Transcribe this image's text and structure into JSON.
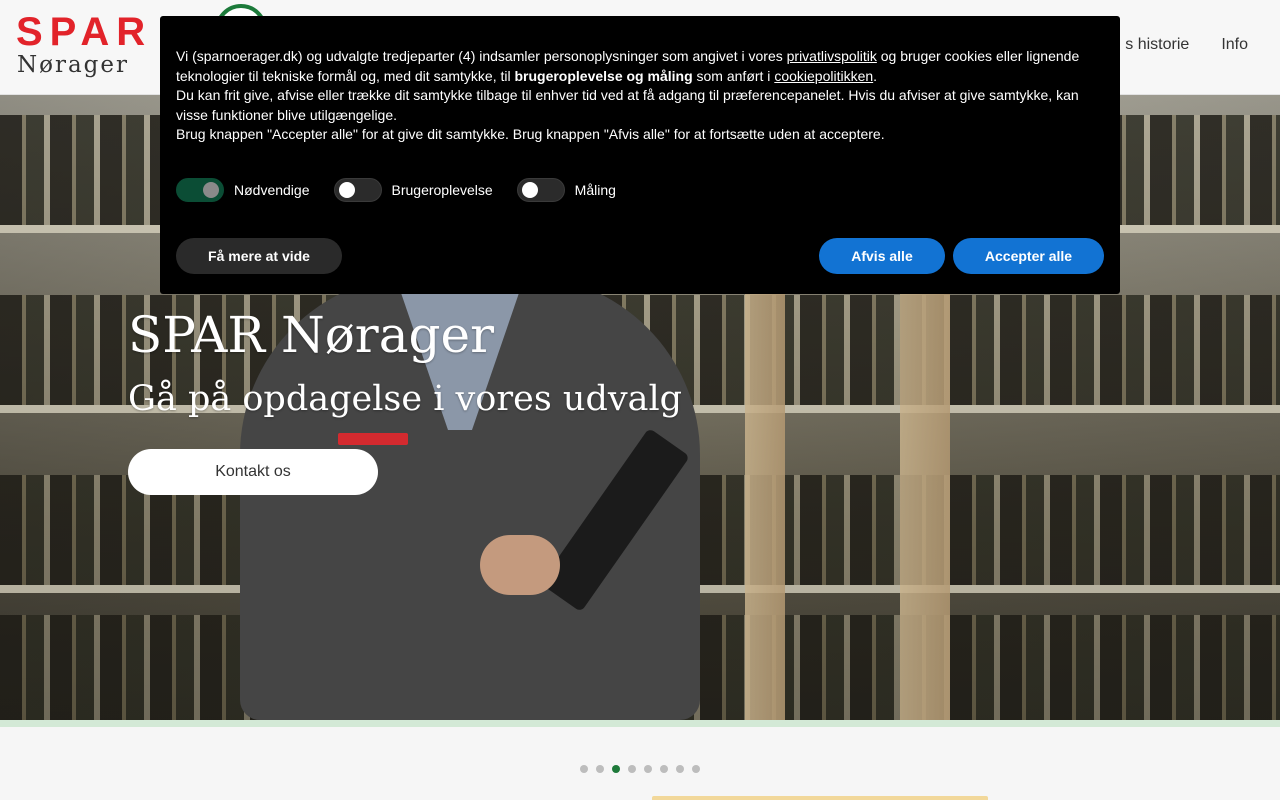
{
  "header": {
    "logo_brand": "SPAR",
    "logo_location": "Nørager",
    "nav_items": [
      "s historie",
      "Info"
    ]
  },
  "hero": {
    "title": "SPAR Nørager",
    "subtitle": "Gå på opdagelse i vores udvalg",
    "button_label": "Kontakt os"
  },
  "carousel": {
    "dot_count": 8,
    "active_index": 2
  },
  "cookie": {
    "p1_a": "Vi (sparnoerager.dk) og udvalgte tredjeparter (4) indsamler personoplysninger som angivet i vores ",
    "privacy_link": "privatlivspolitik",
    "p1_b": " og bruger cookies eller lignende teknologier til tekniske formål og, med dit samtykke, til ",
    "p1_bold": "brugeroplevelse og måling",
    "p1_c": " som anført i ",
    "cookie_link": "cookiepolitikken",
    "p1_d": ".",
    "p2": "Du kan frit give, afvise eller trække dit samtykke tilbage til enhver tid ved at få adgang til præferencepanelet. Hvis du afviser at give samtykke, kan visse funktioner blive utilgængelige.",
    "p3": "Brug knappen \"Accepter alle\" for at give dit samtykke. Brug knappen \"Afvis alle\" for at fortsætte uden at acceptere.",
    "toggles": [
      {
        "label": "Nødvendige",
        "on": true
      },
      {
        "label": "Brugeroplevelse",
        "on": false
      },
      {
        "label": "Måling",
        "on": false
      }
    ],
    "more_label": "Få mere at vide",
    "reject_label": "Afvis alle",
    "accept_label": "Accepter alle"
  },
  "colors": {
    "brand_red": "#e2232a",
    "brand_green": "#1e7a3a",
    "button_blue": "#1273d3"
  }
}
